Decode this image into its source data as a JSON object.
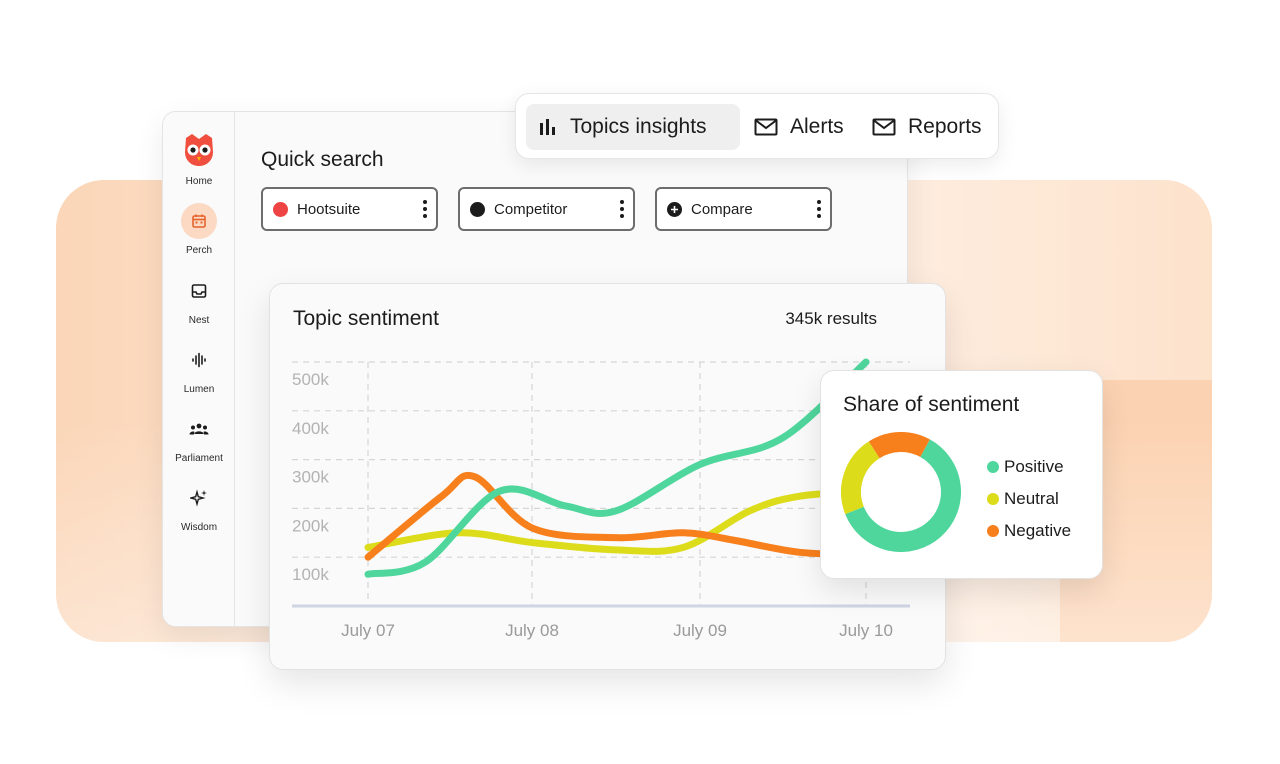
{
  "tabs": [
    {
      "label": "Topics insights",
      "icon": "bar-chart-icon",
      "active": true
    },
    {
      "label": "Alerts",
      "icon": "envelope-icon",
      "active": false
    },
    {
      "label": "Reports",
      "icon": "envelope-icon",
      "active": false
    }
  ],
  "sidebar": {
    "items": [
      {
        "label": "Home",
        "icon": "owl-logo-icon"
      },
      {
        "label": "Perch",
        "icon": "calendar-icon",
        "active": true
      },
      {
        "label": "Nest",
        "icon": "inbox-icon"
      },
      {
        "label": "Lumen",
        "icon": "waveform-icon"
      },
      {
        "label": "Parliament",
        "icon": "people-icon"
      },
      {
        "label": "Wisdom",
        "icon": "sparkle-icon"
      }
    ]
  },
  "quick_search": {
    "title": "Quick search",
    "chips": [
      {
        "label": "Hootsuite",
        "dot": "#ee4444"
      },
      {
        "label": "Competitor",
        "dot": "#1c1c1c"
      },
      {
        "label": "Compare",
        "dot": "plus"
      }
    ]
  },
  "topic_sentiment": {
    "title": "Topic sentiment",
    "count": "345k results"
  },
  "share_of_sentiment": {
    "title": "Share of sentiment"
  },
  "colors": {
    "positive": "#4fd69c",
    "neutral": "#dcdc1a",
    "negative": "#f77f1c",
    "accent": "#f04e3e"
  },
  "chart_data": [
    {
      "type": "line",
      "x": [
        "July 07",
        "July 08",
        "July 09",
        "July 10"
      ],
      "yticks": [
        "500k",
        "400k",
        "300k",
        "200k",
        "100k"
      ],
      "ylim": [
        0,
        500000
      ],
      "grid": true,
      "series": [
        {
          "name": "Positive",
          "color": "#4fd69c",
          "points": [
            [
              0,
              65000
            ],
            [
              0.35,
              90000
            ],
            [
              0.8,
              235000
            ],
            [
              1.2,
              205000
            ],
            [
              1.5,
              195000
            ],
            [
              2.0,
              290000
            ],
            [
              2.5,
              345000
            ],
            [
              3.0,
              500000
            ]
          ]
        },
        {
          "name": "Neutral",
          "color": "#dcdc1a",
          "points": [
            [
              0,
              120000
            ],
            [
              0.55,
              150000
            ],
            [
              1.0,
              130000
            ],
            [
              1.5,
              115000
            ],
            [
              1.9,
              120000
            ],
            [
              2.3,
              195000
            ],
            [
              2.6,
              225000
            ],
            [
              3.0,
              235000
            ]
          ]
        },
        {
          "name": "Negative",
          "color": "#f77f1c",
          "points": [
            [
              0,
              100000
            ],
            [
              0.45,
              225000
            ],
            [
              0.65,
              265000
            ],
            [
              1.0,
              160000
            ],
            [
              1.5,
              140000
            ],
            [
              1.9,
              150000
            ],
            [
              2.2,
              135000
            ],
            [
              2.6,
              110000
            ],
            [
              3.0,
              105000
            ]
          ]
        }
      ]
    },
    {
      "type": "pie",
      "categories": [
        "Positive",
        "Neutral",
        "Negative"
      ],
      "values": [
        61,
        22,
        17
      ],
      "colors": [
        "#4fd69c",
        "#dcdc1a",
        "#f77f1c"
      ]
    }
  ]
}
